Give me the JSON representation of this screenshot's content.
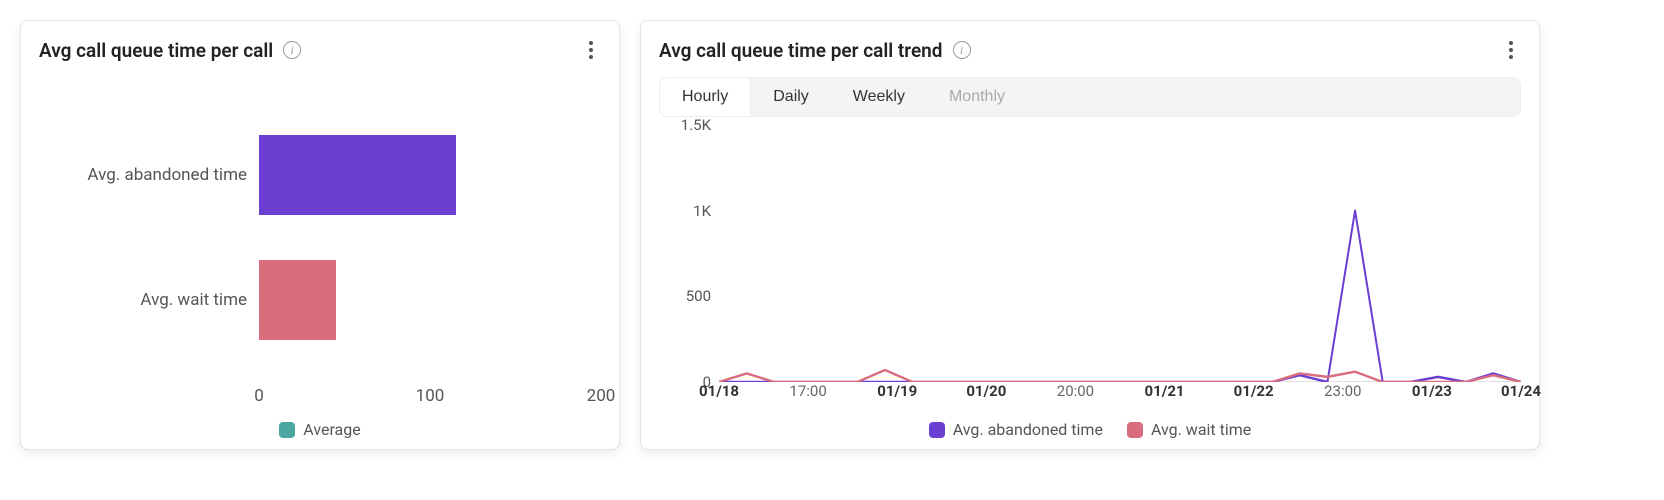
{
  "colors": {
    "purple": "#6c3fd3",
    "pink": "#d96c7d",
    "teal": "#4aa7a0"
  },
  "left": {
    "title": "Avg call queue time per call",
    "legend": "Average",
    "axis_ticks": [
      "0",
      "100",
      "200"
    ]
  },
  "right": {
    "title": "Avg call queue time per call trend",
    "segments": {
      "hourly": "Hourly",
      "daily": "Daily",
      "weekly": "Weekly",
      "monthly": "Monthly"
    },
    "legend": {
      "abandoned": "Avg. abandoned time",
      "wait": "Avg. wait time"
    }
  },
  "chart_data": [
    {
      "type": "bar",
      "orientation": "horizontal",
      "title": "Avg call queue time per call",
      "xlabel": "",
      "ylabel": "",
      "xlim": [
        0,
        200
      ],
      "categories": [
        "Avg. abandoned time",
        "Avg. wait time"
      ],
      "series": [
        {
          "name": "Average",
          "values": [
            115,
            45
          ],
          "colors": [
            "#6c3fd3",
            "#d96c7d"
          ]
        }
      ]
    },
    {
      "type": "line",
      "title": "Avg call queue time per call trend",
      "xlabel": "",
      "ylabel": "",
      "ylim": [
        0,
        1500
      ],
      "y_ticks": [
        "0",
        "500",
        "1K",
        "1.5K"
      ],
      "x_ticks": [
        {
          "label": "01/18",
          "bold": true
        },
        {
          "label": "17:00",
          "bold": false
        },
        {
          "label": "01/19",
          "bold": true
        },
        {
          "label": "01/20",
          "bold": true
        },
        {
          "label": "20:00",
          "bold": false
        },
        {
          "label": "01/21",
          "bold": true
        },
        {
          "label": "01/22",
          "bold": true
        },
        {
          "label": "23:00",
          "bold": false
        },
        {
          "label": "01/23",
          "bold": true
        },
        {
          "label": "01/24",
          "bold": true
        }
      ],
      "x": [
        0,
        1,
        2,
        3,
        4,
        5,
        6,
        7,
        8,
        9,
        10,
        11,
        12,
        13,
        14,
        15,
        16,
        17,
        18,
        19,
        20,
        21,
        22,
        23,
        24,
        25,
        26,
        27,
        28,
        29
      ],
      "series": [
        {
          "name": "Avg. abandoned time",
          "color": "#6c3fd3",
          "values": [
            0,
            0,
            0,
            0,
            0,
            0,
            0,
            0,
            0,
            0,
            0,
            0,
            0,
            0,
            0,
            0,
            0,
            0,
            0,
            0,
            0,
            40,
            0,
            1000,
            0,
            0,
            30,
            0,
            50,
            0
          ]
        },
        {
          "name": "Avg. wait time",
          "color": "#d96c7d",
          "values": [
            0,
            50,
            0,
            0,
            0,
            0,
            70,
            0,
            0,
            0,
            0,
            0,
            0,
            0,
            0,
            0,
            0,
            0,
            0,
            0,
            0,
            50,
            30,
            60,
            0,
            0,
            0,
            0,
            40,
            0
          ]
        }
      ]
    }
  ]
}
